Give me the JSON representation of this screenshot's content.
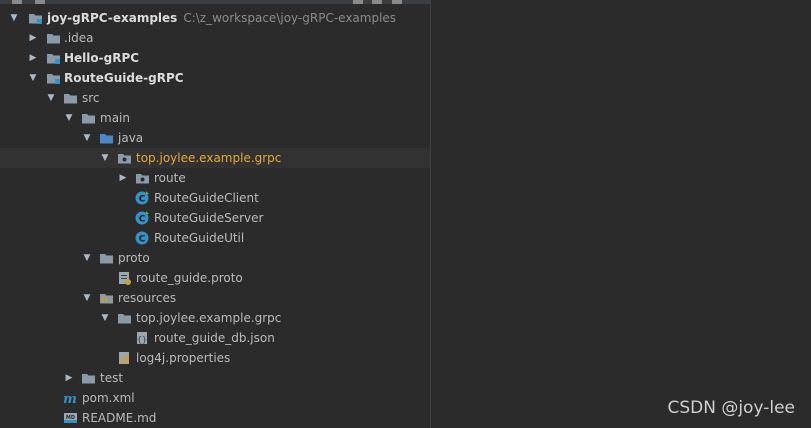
{
  "project": {
    "name": "joy-gRPC-examples",
    "path": "C:\\z_workspace\\joy-gRPC-examples"
  },
  "tree": [
    {
      "label": ".idea",
      "icon": "folder-icon",
      "expanded": false
    },
    {
      "label": "Hello-gRPC",
      "icon": "module-folder-icon",
      "expanded": false
    },
    {
      "label": "RouteGuide-gRPC",
      "icon": "module-folder-icon",
      "expanded": true
    },
    {
      "label": "src",
      "icon": "folder-icon",
      "expanded": true
    },
    {
      "label": "main",
      "icon": "folder-icon",
      "expanded": true
    },
    {
      "label": "java",
      "icon": "source-folder-icon",
      "expanded": true
    },
    {
      "label": "top.joylee.example.grpc",
      "icon": "package-icon",
      "expanded": true
    },
    {
      "label": "route",
      "icon": "package-icon",
      "expanded": false
    },
    {
      "label": "RouteGuideClient",
      "icon": "java-class-icon"
    },
    {
      "label": "RouteGuideServer",
      "icon": "java-class-icon"
    },
    {
      "label": "RouteGuideUtil",
      "icon": "java-class-icon"
    },
    {
      "label": "proto",
      "icon": "folder-icon",
      "expanded": true
    },
    {
      "label": "route_guide.proto",
      "icon": "proto-file-icon"
    },
    {
      "label": "resources",
      "icon": "resources-folder-icon",
      "expanded": true
    },
    {
      "label": "top.joylee.example.grpc",
      "icon": "folder-icon",
      "expanded": true
    },
    {
      "label": "route_guide_db.json",
      "icon": "json-file-icon"
    },
    {
      "label": "log4j.properties",
      "icon": "properties-file-icon"
    },
    {
      "label": "test",
      "icon": "folder-icon",
      "expanded": false
    },
    {
      "label": "pom.xml",
      "icon": "maven-icon"
    },
    {
      "label": "README.md",
      "icon": "markdown-icon"
    }
  ],
  "watermark": "CSDN @joy-lee",
  "colors": {
    "background": "#2b2b2b",
    "selected_row": "#0d293e",
    "highlight_text": "#e8a838",
    "folder": "#8a9aa9",
    "source_folder": "#4a88c7",
    "class_icon": "#3592c4"
  }
}
